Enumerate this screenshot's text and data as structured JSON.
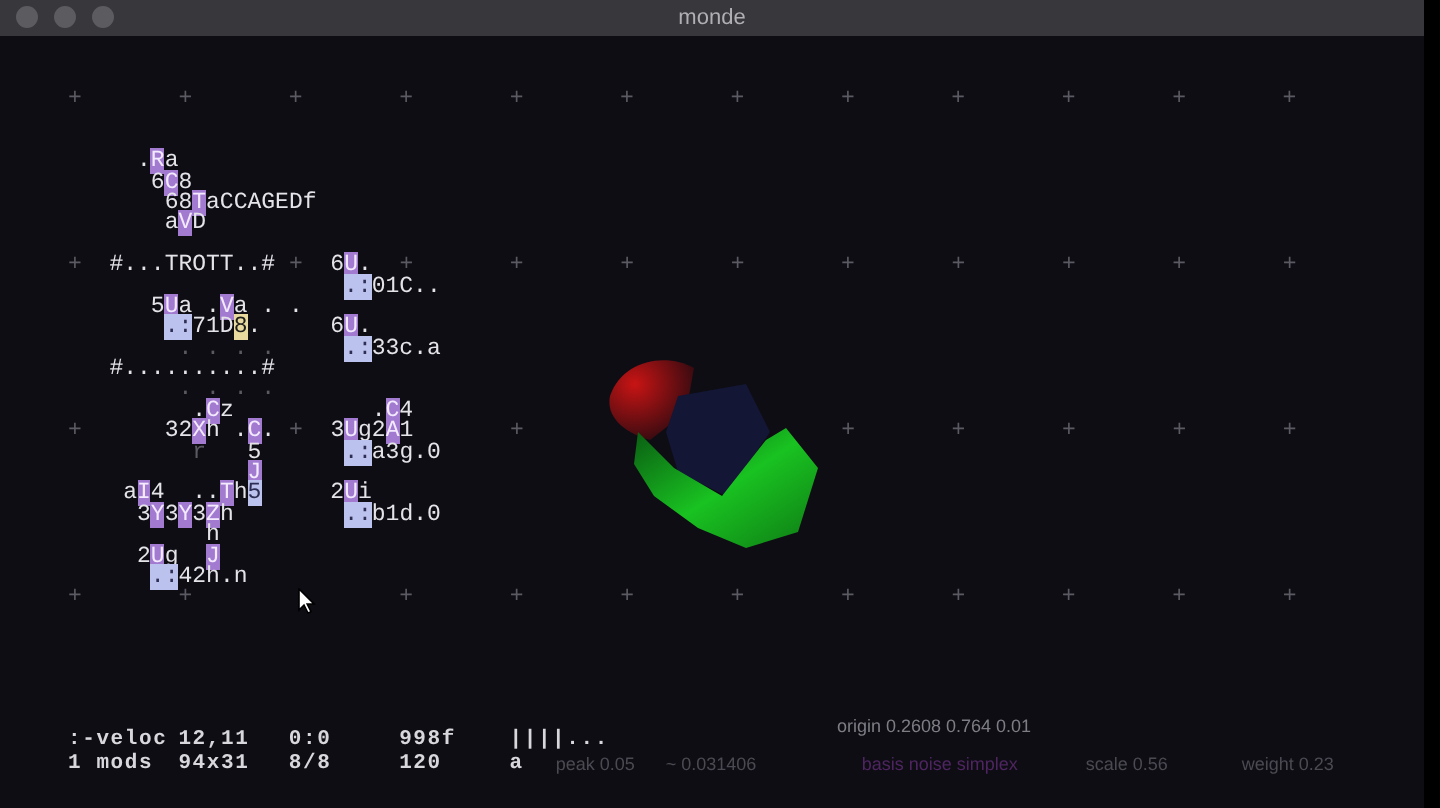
{
  "window": {
    "title": "monde"
  },
  "grid": {
    "lines": [
      {
        "segments": [
          {
            "text": "+       +       +       +       +       +       +       +       +       +       +       +",
            "kind": "grid"
          }
        ]
      },
      {
        "segments": [
          {
            "text": "     .",
            "kind": "plain"
          },
          {
            "text": "R",
            "kind": "op"
          },
          {
            "text": "a",
            "kind": "plain"
          }
        ]
      },
      {
        "segments": [
          {
            "text": "      6",
            "kind": "plain"
          },
          {
            "text": "C",
            "kind": "op"
          },
          {
            "text": "8",
            "kind": "plain"
          }
        ]
      },
      {
        "segments": [
          {
            "text": "       68",
            "kind": "plain"
          },
          {
            "text": "T",
            "kind": "op"
          },
          {
            "text": "aCCAGEDf",
            "kind": "plain"
          }
        ]
      },
      {
        "segments": [
          {
            "text": "       a",
            "kind": "plain"
          },
          {
            "text": "V",
            "kind": "op"
          },
          {
            "text": "D",
            "kind": "plain"
          }
        ]
      },
      {
        "segments": [
          {
            "text": "+",
            "kind": "grid"
          },
          {
            "text": "  #...TROTT..# ",
            "kind": "plain"
          },
          {
            "text": "+",
            "kind": "grid"
          },
          {
            "text": "  6",
            "kind": "plain"
          },
          {
            "text": "U",
            "kind": "op"
          },
          {
            "text": ".",
            "kind": "plain"
          },
          {
            "text": "  +       +       +       +       +       +       +       +       +",
            "kind": "grid"
          }
        ]
      },
      {
        "segments": [
          {
            "text": "                    .:",
            "kind": "port"
          },
          {
            "text": "01C..",
            "kind": "plain"
          }
        ]
      },
      {
        "segments": [
          {
            "text": "      5",
            "kind": "plain"
          },
          {
            "text": "U",
            "kind": "op"
          },
          {
            "text": "a .",
            "kind": "plain"
          },
          {
            "text": "V",
            "kind": "op"
          },
          {
            "text": "a . .",
            "kind": "plain"
          }
        ]
      },
      {
        "segments": [
          {
            "text": "       .:",
            "kind": "port"
          },
          {
            "text": "71D",
            "kind": "plain"
          },
          {
            "text": "8",
            "kind": "cursor"
          },
          {
            "text": ".     6",
            "kind": "plain"
          },
          {
            "text": "U",
            "kind": "op"
          },
          {
            "text": ".",
            "kind": "plain"
          }
        ]
      },
      {
        "segments": [
          {
            "text": "        . . . .",
            "kind": "grid"
          },
          {
            "text": "     .:",
            "kind": "port"
          },
          {
            "text": "33c.a",
            "kind": "plain"
          }
        ]
      },
      {
        "segments": [
          {
            "text": "   #..........#",
            "kind": "plain"
          }
        ]
      },
      {
        "segments": [
          {
            "text": "        . . . .",
            "kind": "grid"
          }
        ]
      },
      {
        "segments": [
          {
            "text": "         .",
            "kind": "plain"
          },
          {
            "text": "C",
            "kind": "op"
          },
          {
            "text": "z          .",
            "kind": "plain"
          },
          {
            "text": "C",
            "kind": "op"
          },
          {
            "text": "4",
            "kind": "plain"
          }
        ]
      },
      {
        "segments": [
          {
            "text": "+",
            "kind": "grid"
          },
          {
            "text": "      32",
            "kind": "plain"
          },
          {
            "text": "X",
            "kind": "op"
          },
          {
            "text": "h .",
            "kind": "plain"
          },
          {
            "text": "C",
            "kind": "op"
          },
          {
            "text": ". ",
            "kind": "plain"
          },
          {
            "text": "+",
            "kind": "grid"
          },
          {
            "text": "  3",
            "kind": "plain"
          },
          {
            "text": "U",
            "kind": "op"
          },
          {
            "text": "g2",
            "kind": "plain"
          },
          {
            "text": "A",
            "kind": "op"
          },
          {
            "text": "1",
            "kind": "plain"
          },
          {
            "text": "       +",
            "kind": "grid"
          },
          {
            "text": "                       +       +       +       +       +",
            "kind": "grid"
          }
        ]
      },
      {
        "segments": [
          {
            "text": "         r",
            "kind": "grid"
          },
          {
            "text": "   5",
            "kind": "plain"
          },
          {
            "text": "      .:",
            "kind": "port"
          },
          {
            "text": "a3g.0",
            "kind": "plain"
          }
        ]
      },
      {
        "segments": [
          {
            "text": "             J",
            "kind": "op"
          }
        ]
      },
      {
        "segments": [
          {
            "text": "    a",
            "kind": "plain"
          },
          {
            "text": "I",
            "kind": "op"
          },
          {
            "text": "4  ..",
            "kind": "plain"
          },
          {
            "text": "T",
            "kind": "op"
          },
          {
            "text": "h",
            "kind": "plain"
          },
          {
            "text": "5",
            "kind": "port"
          },
          {
            "text": "     2",
            "kind": "plain"
          },
          {
            "text": "U",
            "kind": "op"
          },
          {
            "text": "i",
            "kind": "plain"
          }
        ]
      },
      {
        "segments": [
          {
            "text": "     3",
            "kind": "plain"
          },
          {
            "text": "Y",
            "kind": "op"
          },
          {
            "text": "3",
            "kind": "plain"
          },
          {
            "text": "Y",
            "kind": "op"
          },
          {
            "text": "3",
            "kind": "plain"
          },
          {
            "text": "Z",
            "kind": "op"
          },
          {
            "text": "h",
            "kind": "plain"
          },
          {
            "text": "        .:",
            "kind": "port"
          },
          {
            "text": "b1d.0",
            "kind": "plain"
          }
        ]
      },
      {
        "segments": [
          {
            "text": "          h",
            "kind": "plain"
          }
        ]
      },
      {
        "segments": [
          {
            "text": "     2",
            "kind": "plain"
          },
          {
            "text": "U",
            "kind": "op"
          },
          {
            "text": "g",
            "kind": "plain"
          },
          {
            "text": "  J",
            "kind": "op"
          }
        ]
      },
      {
        "segments": [
          {
            "text": "      .:",
            "kind": "port"
          },
          {
            "text": "42h.n",
            "kind": "plain"
          }
        ]
      },
      {
        "segments": [
          {
            "text": "+       +",
            "kind": "grid"
          },
          {
            "text": "               +       +       +       +       +       +       +       +       +",
            "kind": "grid"
          }
        ]
      }
    ]
  },
  "status_bar": {
    "rows": [
      {
        "cells": [
          ":-veloc",
          "12,11",
          "0:0",
          "998f",
          "||||..."
        ]
      },
      {
        "cells": [
          "1 mods",
          "94x31",
          "8/8",
          "120",
          "a"
        ]
      }
    ]
  },
  "readouts": {
    "origin": "origin 0.2608 0.764 0.01",
    "items": [
      {
        "text": "peak 0.05",
        "kind": "plain"
      },
      {
        "text": "~ 0.031406",
        "kind": "plain"
      },
      {
        "text": "basis noise simplex",
        "kind": "accent"
      },
      {
        "text": "scale 0.56",
        "kind": "plain"
      },
      {
        "text": "weight 0.23",
        "kind": "plain"
      }
    ]
  }
}
